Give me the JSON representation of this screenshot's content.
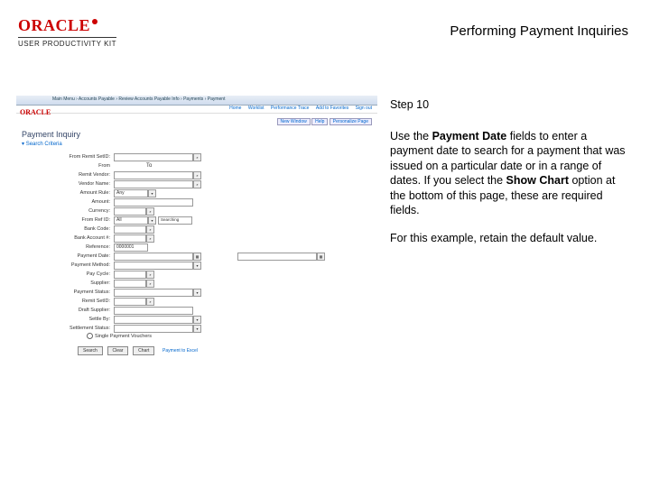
{
  "header": {
    "brand": "ORACLE",
    "kit": "USER PRODUCTIVITY KIT",
    "page_title": "Performing Payment Inquiries"
  },
  "instruction": {
    "step": "Step 10",
    "body_pre": "Use the ",
    "body_b1": "Payment Date",
    "body_mid": " fields to enter a payment date to search for a payment that was issued on a particular date or in a range of dates. If you select the ",
    "body_b2": "Show Chart",
    "body_post": " option at the bottom of this page, these are required fields.",
    "note": "For this example, retain the default value."
  },
  "thumb": {
    "crumbs": "Main Menu  ›  Accounts Payable  ›  Review Accounts Payable Info  ›  Payments  ›  Payment",
    "links": {
      "a": "Home",
      "b": "Worklist",
      "c": "Performance Trace",
      "d": "Add to Favorites",
      "e": "Sign out"
    },
    "brand": "ORACLE",
    "tabs": {
      "a": "New Window",
      "b": "Help",
      "c": "Personalize Page"
    },
    "title": "Payment Inquiry",
    "section": "Search Criteria",
    "labels": {
      "l1": "From Remit SetID:",
      "l2": "From",
      "l3": "Remit Vendor:",
      "l4": "Vendor Name:",
      "l5": "Amount Rule:",
      "l6": "Amount:",
      "l7": "Currency:",
      "l8": "From Ref ID:",
      "l9": "Bank Code:",
      "l10": "Bank Account #:",
      "l11": "Reference:",
      "l12": "Payment Date:",
      "l13": "Payment Method:",
      "l14": "Pay Cycle:",
      "l15": "Supplier:",
      "l16": "Payment Status:",
      "l17": "Remit SetID:",
      "l18": "Draft Supplier:",
      "l19": "Settle By:",
      "l20": "Settlement Status:"
    },
    "values": {
      "v1": "Any",
      "v2": "All",
      "v3": "Searching",
      "v4": "0000001"
    },
    "to": "To",
    "radio": "Single Payment Vouchers",
    "buttons": {
      "b1": "Search",
      "b2": "Clear",
      "b3": "Chart"
    },
    "linklabel": "Payment to Excel"
  }
}
